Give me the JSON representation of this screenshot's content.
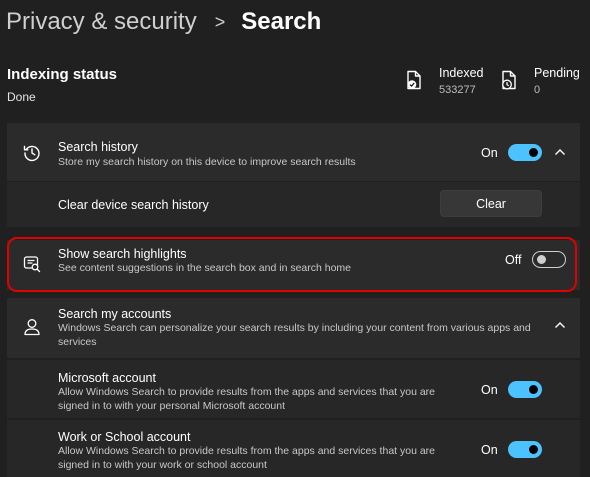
{
  "breadcrumb": {
    "parent": "Privacy & security",
    "separator": ">",
    "current": "Search"
  },
  "indexing": {
    "title": "Indexing status",
    "status": "Done",
    "indexed": {
      "label": "Indexed",
      "value": "533277"
    },
    "pending": {
      "label": "Pending",
      "value": "0"
    }
  },
  "search_history": {
    "title": "Search history",
    "description": "Store my search history on this device to improve search results",
    "state": "On",
    "clear_label": "Clear device search history",
    "clear_button": "Clear"
  },
  "search_highlights": {
    "title": "Show search highlights",
    "description": "See content suggestions in the search box and in search home",
    "state": "Off"
  },
  "search_accounts": {
    "title": "Search my accounts",
    "description": "Windows Search can personalize your search results by including your content from various apps and services",
    "microsoft": {
      "title": "Microsoft account",
      "description": "Allow Windows Search to provide results from the apps and services that you are signed in to with your personal Microsoft account",
      "state": "On"
    },
    "work": {
      "title": "Work or School account",
      "description": "Allow Windows Search to provide results from the apps and services that you are signed in to with your work or school account",
      "state": "On"
    }
  },
  "colors": {
    "accent": "#4cc2ff",
    "highlight_border": "#e00000",
    "background": "#202020",
    "card": "#2b2b2b"
  }
}
